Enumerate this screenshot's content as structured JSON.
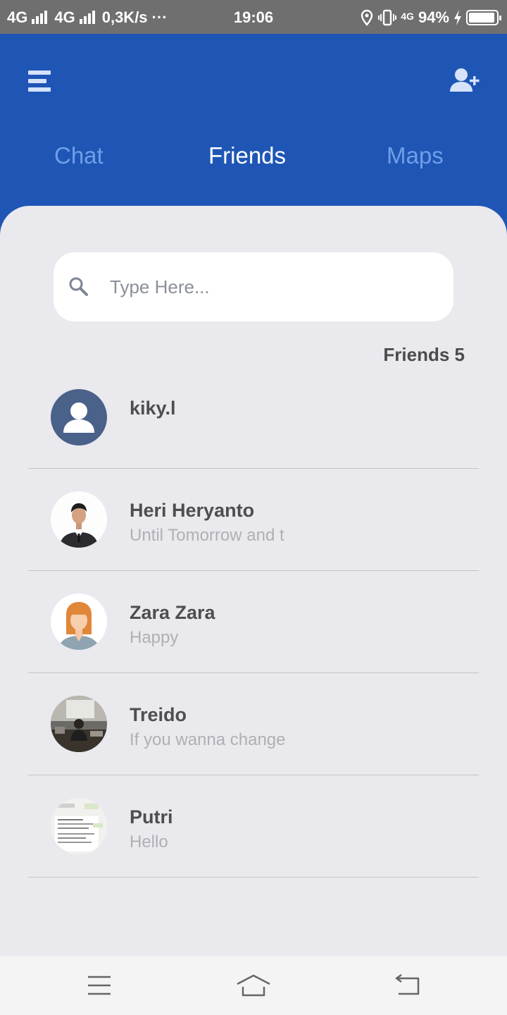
{
  "status_bar": {
    "sim1": "4G",
    "sim2": "4G",
    "speed": "0,3K/s",
    "more": "···",
    "time": "19:06",
    "net": "4G",
    "battery": "94%",
    "battery_level": 0.94
  },
  "header": {
    "tabs": [
      {
        "label": "Chat",
        "active": false
      },
      {
        "label": "Friends",
        "active": true
      },
      {
        "label": "Maps",
        "active": false
      }
    ]
  },
  "search": {
    "placeholder": "Type Here...",
    "value": ""
  },
  "friends_count_label": "Friends 5",
  "friends": [
    {
      "name": "kiky.l",
      "message": "",
      "avatar": "default-user-icon"
    },
    {
      "name": "Heri Heryanto",
      "message": "Until Tomorrow and t",
      "avatar": "photo-man-suit"
    },
    {
      "name": "Zara Zara",
      "message": "Happy",
      "avatar": "cartoon-woman"
    },
    {
      "name": "Treido",
      "message": "If you wanna change",
      "avatar": "photo-office"
    },
    {
      "name": "Putri",
      "message": "Hello",
      "avatar": "photo-document"
    }
  ],
  "colors": {
    "header_blue": "#1f56b5",
    "inactive_tab": "#6f9ee8",
    "background": "#e9e9ee",
    "default_avatar": "#4a6189"
  }
}
